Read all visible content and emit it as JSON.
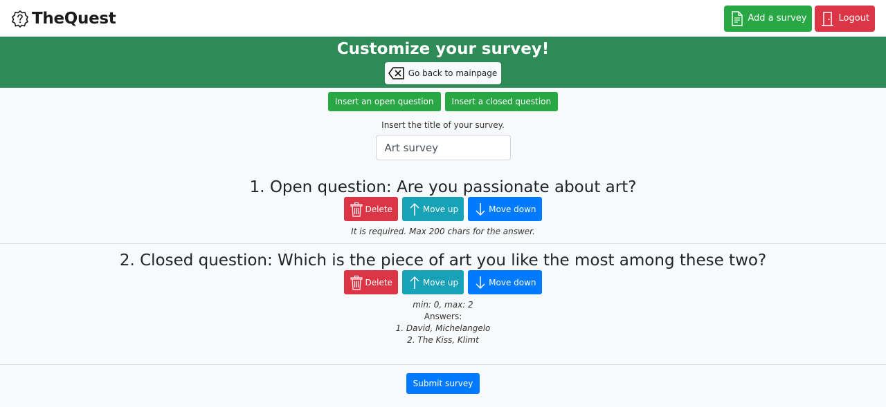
{
  "navbar": {
    "brand": "TheQuest",
    "add_survey_label": "Add a survey",
    "logout_label": "Logout"
  },
  "banner": {
    "title": "Customize your survey!",
    "back_label": "Go back to mainpage"
  },
  "editor": {
    "insert_open_label": "Insert an open question",
    "insert_closed_label": "Insert a closed question",
    "title_prompt": "Insert the title of your survey.",
    "title_value": "Art survey"
  },
  "questions": [
    {
      "title": "1. Open question: Are you passionate about art?",
      "delete_label": "Delete",
      "up_label": "Move up",
      "down_label": "Move down",
      "info": "It is required. Max 200 chars for the answer."
    },
    {
      "title": "2. Closed question: Which is the piece of art you like the most among these two?",
      "delete_label": "Delete",
      "up_label": "Move up",
      "down_label": "Move down",
      "info": "min: 0, max: 2",
      "answers_label": "Answers:",
      "answers": [
        "1. David, Michelangelo",
        "2. The Kiss, Klimt"
      ]
    }
  ],
  "submit_label": "Submit survey",
  "colors": {
    "green": "#28a745",
    "banner_green": "#2e8b57",
    "red": "#dc3545",
    "teal": "#17a2b8",
    "blue": "#007bff"
  },
  "icons": [
    "question-badge-icon",
    "document-icon",
    "door-icon",
    "backspace-icon",
    "trash-icon",
    "arrow-up-icon",
    "arrow-down-icon"
  ]
}
